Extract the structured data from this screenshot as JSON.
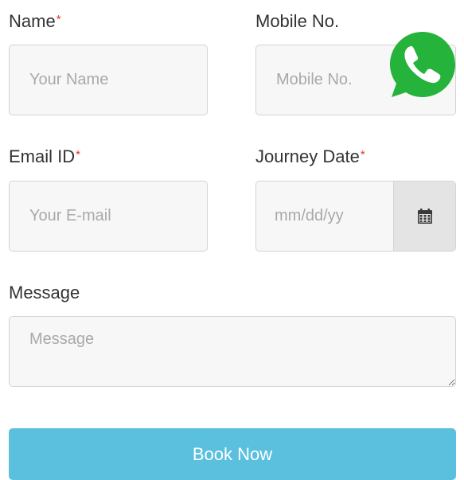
{
  "form": {
    "name": {
      "label": "Name",
      "required_mark": "*",
      "placeholder": "Your Name",
      "value": ""
    },
    "mobile": {
      "label": "Mobile No.",
      "placeholder": "Mobile No.",
      "value": ""
    },
    "email": {
      "label": "Email ID",
      "required_mark": "*",
      "placeholder": "Your E-mail",
      "value": ""
    },
    "journey_date": {
      "label": "Journey Date",
      "required_mark": "*",
      "placeholder": "mm/dd/yy",
      "value": ""
    },
    "message": {
      "label": "Message",
      "placeholder": "Message",
      "value": ""
    },
    "submit_label": "Book Now"
  },
  "icons": {
    "whatsapp": "whatsapp-phone-icon",
    "calendar": "calendar-icon"
  },
  "colors": {
    "required": "#e0352b",
    "button": "#5bc0de",
    "whatsapp": "#25b33c",
    "input_bg": "#f7f7f7",
    "input_border": "#d4d4d4",
    "addon_bg": "#e4e4e4"
  }
}
